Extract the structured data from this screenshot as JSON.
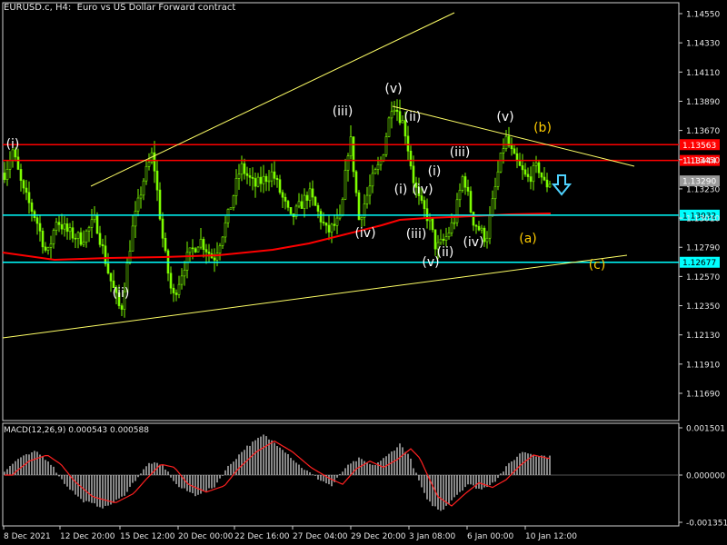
{
  "chart_header": {
    "symbol": "EURUSD.c",
    "timeframe": "H4",
    "description": "Euro vs US Dollar Forward contract"
  },
  "colors": {
    "background": "#000000",
    "candles": "#7CFC00",
    "grid": "#333333",
    "resistance": "#FF0000",
    "support": "#00FFFF",
    "trendline": "#FFFF66",
    "moving_average": "#FF0000",
    "wave_labels": "#FFFFFF",
    "abc_labels": "#FFCC00",
    "arrow": "#4FD3FF",
    "macd_histogram": "#C0C0C0",
    "macd_signal": "#FF2020"
  },
  "price_axis": {
    "ticks": [
      "1.14550",
      "1.14330",
      "1.14110",
      "1.13890",
      "1.13670",
      "1.13450",
      "1.13230",
      "1.13010",
      "1.12790",
      "1.12570",
      "1.12350",
      "1.12130",
      "1.11910",
      "1.11690"
    ]
  },
  "price_levels": [
    {
      "label": "1.13563",
      "kind": "resistance"
    },
    {
      "label": "1.13444",
      "kind": "resistance"
    },
    {
      "label": "1.13290",
      "kind": "current"
    },
    {
      "label": "1.13032",
      "kind": "support"
    },
    {
      "label": "1.12677",
      "kind": "support"
    }
  ],
  "time_axis": {
    "labels": [
      "8 Dec 2021",
      "12 Dec 20:00",
      "15 Dec 12:00",
      "20 Dec 00:00",
      "22 Dec 16:00",
      "27 Dec 04:00",
      "29 Dec 20:00",
      "3 Jan 08:00",
      "6 Jan 00:00",
      "10 Jan 12:00"
    ]
  },
  "wave_labels": [
    {
      "text": "(i)",
      "style": "white"
    },
    {
      "text": "(ii)",
      "style": "white"
    },
    {
      "text": "(iii)",
      "style": "white"
    },
    {
      "text": "(iv)",
      "style": "white"
    },
    {
      "text": "(v)",
      "style": "white"
    },
    {
      "text": "(ii)",
      "style": "white"
    },
    {
      "text": "(i)",
      "style": "white"
    },
    {
      "text": "(iv)",
      "style": "white"
    },
    {
      "text": "(iii)",
      "style": "white"
    },
    {
      "text": "(v)",
      "style": "white"
    },
    {
      "text": "(ii)",
      "style": "white"
    },
    {
      "text": "(i)",
      "style": "white"
    },
    {
      "text": "(iii)",
      "style": "white"
    },
    {
      "text": "(iv)",
      "style": "white"
    },
    {
      "text": "(v)",
      "style": "white"
    },
    {
      "text": "(b)",
      "style": "yellow"
    },
    {
      "text": "(a)",
      "style": "yellow"
    },
    {
      "text": "(c)",
      "style": "yellow"
    }
  ],
  "macd": {
    "header": "MACD(12,26,9) 0.000543 0.000588",
    "ticks": [
      "0.001501",
      "0.000000",
      "-0.001351"
    ]
  }
}
